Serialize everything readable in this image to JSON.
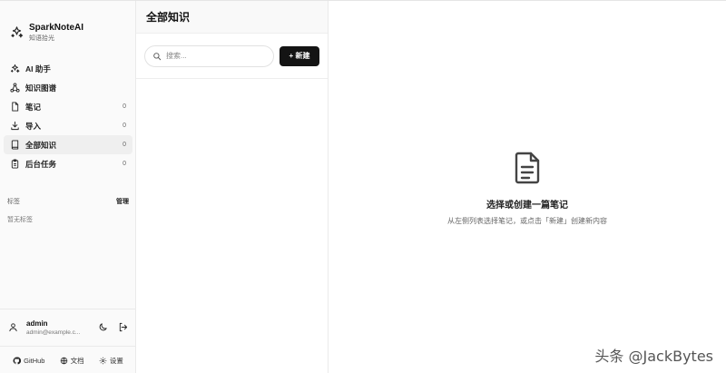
{
  "brand": {
    "title": "SparkNoteAI",
    "subtitle": "知语拾光",
    "icon": "sparkles-icon"
  },
  "nav": [
    {
      "label": "AI 助手",
      "count": "",
      "icon": "sparkles-icon"
    },
    {
      "label": "知识图谱",
      "count": "",
      "icon": "graph-icon"
    },
    {
      "label": "笔记",
      "count": "0",
      "icon": "file-icon"
    },
    {
      "label": "导入",
      "count": "0",
      "icon": "download-icon"
    },
    {
      "label": "全部知识",
      "count": "0",
      "icon": "book-icon",
      "active": true
    },
    {
      "label": "后台任务",
      "count": "0",
      "icon": "clipboard-icon"
    }
  ],
  "tags": {
    "title": "标签",
    "manage": "管理",
    "empty": "暂无标签"
  },
  "user": {
    "name": "admin",
    "email": "admin@example.c..."
  },
  "footer": {
    "github": "GitHub",
    "docs": "文档",
    "settings": "设置"
  },
  "list": {
    "title": "全部知识",
    "search_placeholder": "搜索...",
    "new_label": "+ 新建"
  },
  "main": {
    "empty_title": "选择或创建一篇笔记",
    "empty_subtitle": "从左侧列表选择笔记，或点击「新建」创建新内容"
  },
  "watermark": "头条 @JackBytes"
}
